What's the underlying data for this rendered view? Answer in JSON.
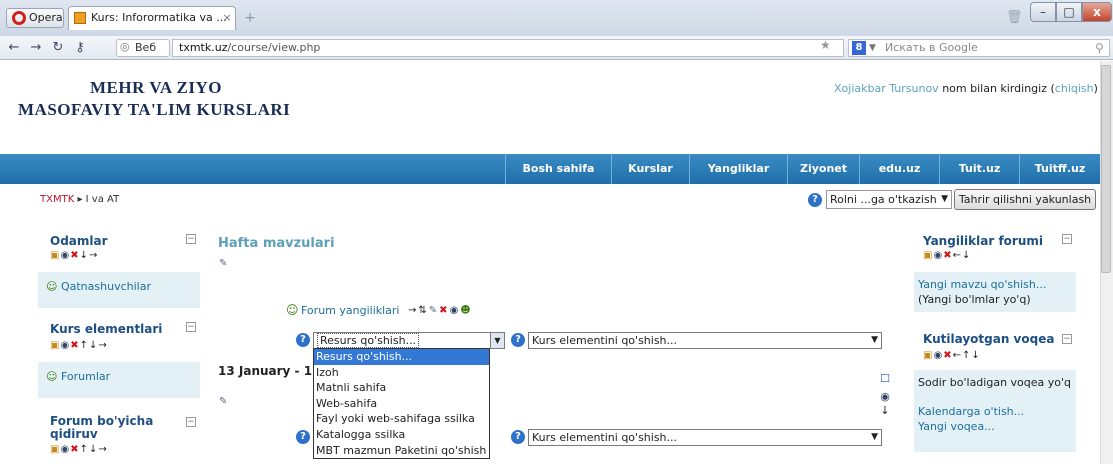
{
  "browser": {
    "menu_label": "Opera",
    "tab_title": "Kurs: Inforormatika va ...",
    "tab_close": "×",
    "new_tab": "+",
    "web_badge": "Веб",
    "url_host": "txmtk.uz",
    "url_path": "/course/view.php",
    "search_placeholder": "Искать в Google",
    "search_engine_letter": "8",
    "window_controls": {
      "minimize": "–",
      "maximize": "□",
      "close": "x"
    }
  },
  "site": {
    "title_line_1": "MEHR VA ZIYO",
    "title_line_2": "MASOFAVIY TA'LIM KURSLARI",
    "login": {
      "user": "Xojiakbar Tursunov",
      "text": " nom bilan kirdingiz (",
      "logout": "chiqish",
      "close": ")"
    }
  },
  "nav": [
    "Bosh sahifa",
    "Kurslar",
    "Yangliklar",
    "Ziyonet",
    "edu.uz",
    "Tuit.uz",
    "Tuitff.uz"
  ],
  "breadcrumb": {
    "root": "TXMTK",
    "sep": " ▸ ",
    "current": "I va AT"
  },
  "toolbar": {
    "role_select": "Rolni ...ga o'tkazish",
    "edit_button": "Tahrir qilishni yakunlash",
    "help": "?"
  },
  "left": {
    "blocks": [
      {
        "title": "Odamlar",
        "body": "Qatnashuvchilar"
      },
      {
        "title": "Kurs elementlari",
        "body": "Forumlar"
      },
      {
        "title_1": "Forum bo'yicha",
        "title_2": "qidiruv"
      }
    ],
    "minimize": "−"
  },
  "main": {
    "topics_title": "Hafta mavzulari",
    "forum_news": "Forum yangiliklari",
    "resource_select": "Resurs qo'shish...",
    "activity_select": "Kurs elementini qo'shish...",
    "dropdown_options": [
      "Resurs qo'shish...",
      "Izoh",
      "Matnli sahifa",
      "Web-sahifa",
      "Fayl yoki web-sahifaga ssilka",
      "Katalogga ssilka",
      "MBT mazmun Paketini qo'shish"
    ],
    "date_heading": "13 January - 1"
  },
  "right": {
    "news": {
      "title": "Yangiliklar forumi",
      "add_topic": "Yangi mavzu qo'shish...",
      "none": "(Yangi bo'lmlar yo'q)"
    },
    "events": {
      "title": "Kutilayotgan voqea",
      "none": "Sodir bo'ladigan voqea yo'q",
      "calendar": "Kalendarga o'tish...",
      "new_event": "Yangi voqea..."
    }
  },
  "colors": {
    "nav_bar": "#1f6ea9",
    "link": "#1d6f9a",
    "title_teal": "#5da1b8",
    "block_bg": "#e3f1f6",
    "select_highlight": "#3478d6"
  }
}
